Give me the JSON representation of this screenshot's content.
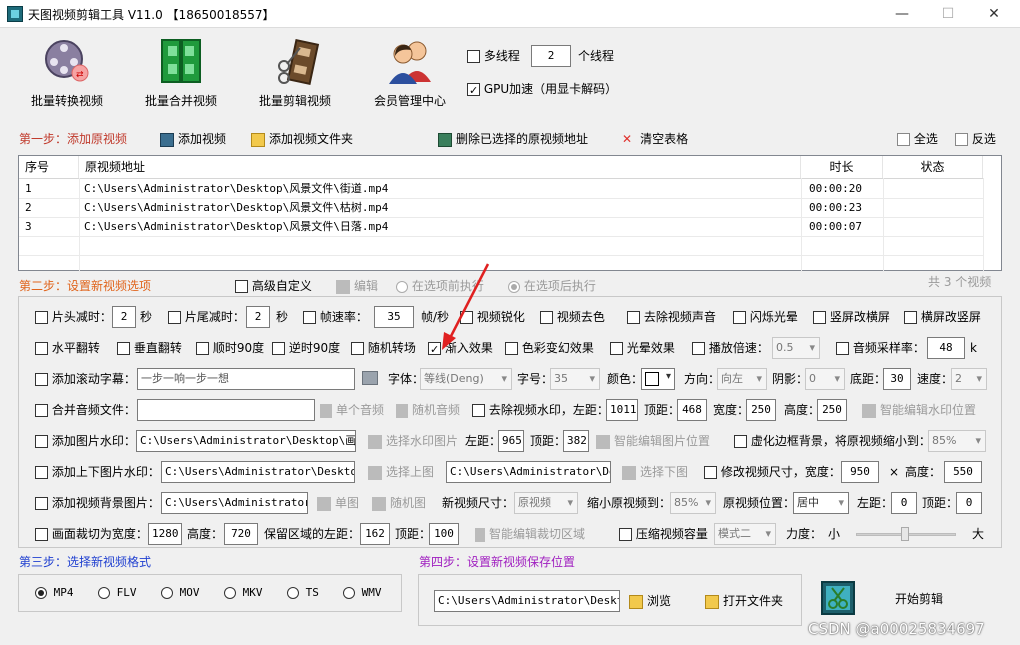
{
  "window": {
    "title": "天图视频剪辑工具 V11.0  【18650018557】",
    "minimize": "—",
    "maximize": "☐",
    "close": "✕"
  },
  "toolbar": {
    "batch_convert": "批量转换视频",
    "batch_merge": "批量合并视频",
    "batch_edit": "批量剪辑视频",
    "member": "会员管理中心",
    "multithread_label": "多线程",
    "thread_count": "2",
    "thread_unit": "个线程",
    "gpu_label": "GPU加速（用显卡解码）"
  },
  "step1": {
    "title": "第一步：添加原视频",
    "add_video": "添加视频",
    "add_folder": "添加视频文件夹",
    "delete_selected": "删除已选择的原视频地址",
    "clear_table": "清空表格",
    "select_all": "全选",
    "invert": "反选"
  },
  "table": {
    "headers": {
      "no": "序号",
      "path": "原视频地址",
      "duration": "时长",
      "status": "状态"
    },
    "rows": [
      {
        "no": "1",
        "path": "C:\\Users\\Administrator\\Desktop\\风景文件\\街道.mp4",
        "duration": "00:00:20",
        "status": ""
      },
      {
        "no": "2",
        "path": "C:\\Users\\Administrator\\Desktop\\风景文件\\枯树.mp4",
        "duration": "00:00:23",
        "status": ""
      },
      {
        "no": "3",
        "path": "C:\\Users\\Administrator\\Desktop\\风景文件\\日落.mp4",
        "duration": "00:00:07",
        "status": ""
      }
    ]
  },
  "step2": {
    "title": "第二步：设置新视频选项",
    "advanced_custom": "高级自定义",
    "edit": "编辑",
    "before_option": "在选项前执行",
    "after_option": "在选项后执行",
    "total": "共 3 个视频",
    "r1": {
      "head_cut": "片头减时：",
      "head_val": "2",
      "sec1": "秒",
      "tail_cut": "片尾减时：",
      "tail_val": "2",
      "sec2": "秒",
      "frame_rate": "帧速率：",
      "fps_val": "35",
      "fps_unit": "帧/秒",
      "sharpen": "视频锐化",
      "decolor": "视频去色",
      "mute": "去除视频声音",
      "flash": "闪烁光晕",
      "v2h": "竖屏改横屏",
      "h2v": "横屏改竖屏"
    },
    "r2": {
      "hflip": "水平翻转",
      "vflip": "垂直翻转",
      "rot90": "顺时90度",
      "rot90ccw": "逆时90度",
      "random_trans": "随机转场",
      "fade_in": "渐入效果",
      "color_fx": "色彩变幻效果",
      "light_fx": "光晕效果",
      "speed": "播放倍速：",
      "speed_val": "0.5",
      "sample_rate": "音频采样率：",
      "sample_val": "48",
      "sample_unit": "k"
    },
    "r3": {
      "scroll_sub": "添加滚动字幕：",
      "sub_text": "一步一响一步一想",
      "font_label": "字体：",
      "font_val": "等线(Deng)",
      "size_label": "字号：",
      "size_val": "35",
      "color_label": "颜色：",
      "dir_label": "方向：",
      "dir_val": "向左",
      "shadow_label": "阴影：",
      "shadow_val": "0",
      "bottom_label": "底距：",
      "bottom_val": "30",
      "speed_label": "速度：",
      "speed_val": "2"
    },
    "r4": {
      "merge_audio": "合并音频文件：",
      "single_audio": "单个音频",
      "random_audio": "随机音频",
      "remove_wm": "去除视频水印，左距：",
      "left": "1011",
      "top_label": "顶距：",
      "top": "468",
      "width_label": "宽度：",
      "width": "250",
      "height_label": "高度：",
      "height": "250",
      "smart_wm": "智能编辑水印位置"
    },
    "r5": {
      "img_wm": "添加图片水印：",
      "img_path": "C:\\Users\\Administrator\\Desktop\\画中画",
      "choose_img": "选择水印图片",
      "left_label": "左距：",
      "left": "965",
      "top_label": "顶距：",
      "top": "382",
      "smart_img": "智能编辑图片位置",
      "blur_border": "虚化边框背景，将原视频缩小到：",
      "scale": "85%"
    },
    "r6": {
      "top_bottom_img": "添加上下图片水印：",
      "top_path": "C:\\Users\\Administrator\\Desktop\\Q",
      "choose_top": "选择上图",
      "bottom_path": "C:\\Users\\Administrator\\Desk",
      "choose_bottom": "选择下图",
      "resize": "修改视频尺寸，宽度：",
      "w": "950",
      "x": "×",
      "h_label": "高度：",
      "h": "550"
    },
    "r7": {
      "bg_img": "添加视频背景图片：",
      "bg_path": "C:\\Users\\Administrator\\D",
      "single_img": "单图",
      "random_img": "随机图",
      "new_size": "新视频尺寸：",
      "new_size_val": "原视频",
      "shrink": "缩小原视频到：",
      "shrink_val": "85%",
      "position": "原视频位置：",
      "position_val": "居中",
      "left_label": "左距：",
      "left": "0",
      "top_label": "顶距：",
      "top": "0"
    },
    "r8": {
      "crop": "画面裁切为宽度：",
      "crop_w": "1280",
      "h_label": "高度：",
      "crop_h": "720",
      "keep_left": "保留区域的左距：",
      "left": "162",
      "top_label": "顶距：",
      "top": "100",
      "smart_crop": "智能编辑裁切区域",
      "compress": "压缩视频容量",
      "mode": "模式二",
      "strength": "力度：",
      "small": "小",
      "big": "大"
    }
  },
  "step3": {
    "title": "第三步：选择新视频格式",
    "formats": [
      "MP4",
      "FLV",
      "MOV",
      "MKV",
      "TS",
      "WMV"
    ]
  },
  "step4": {
    "title": "第四步：设置新视频保存位置",
    "save_path": "C:\\Users\\Administrator\\Desktop\\",
    "browse": "浏览",
    "open_folder": "打开文件夹",
    "start": "开始剪辑"
  },
  "watermark": "CSDN @a00025834697"
}
